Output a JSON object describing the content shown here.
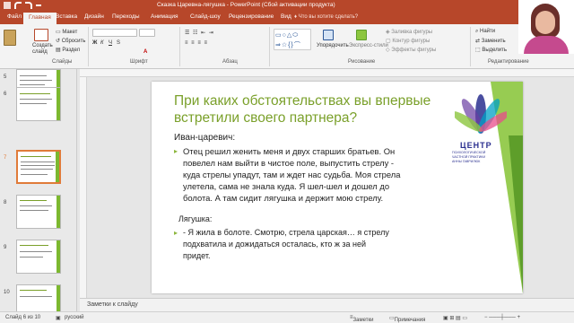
{
  "window": {
    "title": "Сказка Царевна-лягушка - PowerPoint (Сбой активации продукта)"
  },
  "tabs": [
    "Файл",
    "Главная",
    "Вставка",
    "Дизайн",
    "Переходы",
    "Анимация",
    "Слайд-шоу",
    "Рецензирование",
    "Вид"
  ],
  "search_placeholder": "Что вы хотите сделать?",
  "ribbon": {
    "create_slide": "Создать слайд",
    "layout": "Макет",
    "reset": "Сбросить",
    "section": "Раздел",
    "arrange": "Упорядочить",
    "express_styles": "Экспресс-стили",
    "shape_fill": "Заливка фигуры",
    "shape_outline": "Контур фигуры",
    "shape_effects": "Эффекты фигуры",
    "find": "Найти",
    "replace": "Заменить",
    "select": "Выделить",
    "groups": {
      "slides": "Слайды",
      "font": "Шрифт",
      "paragraph": "Абзац",
      "drawing": "Рисование",
      "editing": "Редактирование"
    }
  },
  "slide": {
    "title": "При каких обстоятельствах вы впервые встретили своего партнера?",
    "speaker1": "Иван-царевич:",
    "text1": [
      "Отец решил женить меня и двух старших братьев. Он",
      "повелел нам выйти в чистое поле, выпустить стрелу -",
      "куда стрелы упадут, там и ждет нас судьба. Моя стрела",
      "улетела, сама не знала куда. Я шел-шел и дошел до",
      "болота. А там сидит лягушка и держит мою стрелу."
    ],
    "speaker2": "Лягушка:",
    "text2": [
      "- Я жила в болоте. Смотрю, стрела царская… я стрелу",
      "подхватила и дожидаться осталась, кто ж за ней",
      "придет."
    ],
    "logo": {
      "title": "ЦЕНТР",
      "line1": "ПСИХОЛОГИЧЕСКОЙ",
      "line2": "ЧАСТНОЙ ПРАКТИКИ",
      "line3": "АННЫ ГАВРИЛЮК"
    }
  },
  "thumbnails": [
    "5",
    "6",
    "7",
    "8",
    "9",
    "10"
  ],
  "notes_placeholder": "Заметки к слайду",
  "status": {
    "slide": "Слайд 6 из 10",
    "language": "русский",
    "notes": "Заметки",
    "comments": "Примечания"
  },
  "colors": {
    "accent": "#b7472a",
    "slide_green": "#8cc63f",
    "title_green": "#7aa02a",
    "logo_blue": "#2a2f8f"
  }
}
